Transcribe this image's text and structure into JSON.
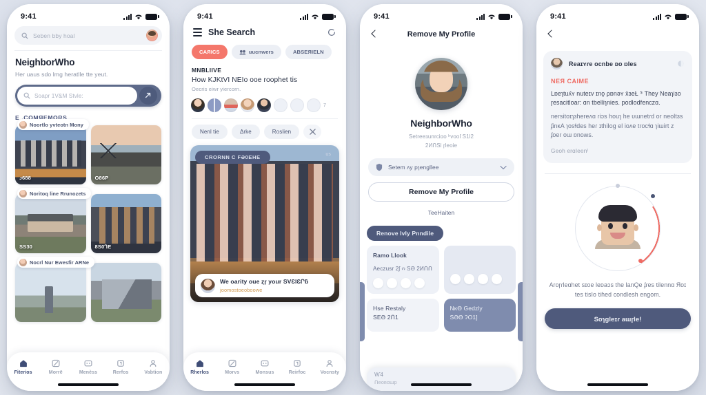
{
  "status_bar": {
    "time": "9:41",
    "signal_icon": "cellular-bars-icon",
    "wifi_icon": "wifi-icon",
    "battery_icon": "battery-icon"
  },
  "panel1": {
    "top_search": {
      "placeholder": "Seben bby hoal",
      "icon": "search-icon",
      "avatar": "user-avatar"
    },
    "heading": "NeighborWho",
    "subheading": "Her uaus sdo lmg heratlle tte yeut.",
    "main_search": {
      "placeholder": "Soapr 1V&M Stvle:",
      "icon": "search-icon",
      "submit_icon": "arrow-icon"
    },
    "section_title": "E .COMЯEMORS",
    "cards": [
      {
        "pill": "Noortlo yvteotn Mony",
        "price": "ᴊ688",
        "img": "listing-photo-modern-townhouse"
      },
      {
        "pill": "",
        "price": "O86P",
        "img": "listing-photo-a-frame-dusk"
      },
      {
        "pill": "Noritoq line Rrunozets",
        "price": "SS30",
        "img": "listing-photo-hillside-house"
      },
      {
        "pill": "",
        "price": "8S0ᒉE",
        "img": "listing-photo-apartment-block"
      },
      {
        "pill": "Nocrl Nur Ewesfir ARNe",
        "price": "",
        "img": "listing-photo-patio"
      },
      {
        "pill": "",
        "price": "",
        "img": "listing-photo-glass-house"
      }
    ],
    "tabs": [
      {
        "label": "Fiterios",
        "icon": "home-icon",
        "active": true
      },
      {
        "label": "Morrë",
        "icon": "image-icon",
        "active": false
      },
      {
        "label": "Menèss",
        "icon": "message-icon",
        "active": false
      },
      {
        "label": "Rerfos",
        "icon": "calendar-icon",
        "active": false
      },
      {
        "label": "Vabtion",
        "icon": "person-icon",
        "active": false
      }
    ]
  },
  "panel2": {
    "menu_icon": "hamburger-menu-icon",
    "title": "She Search",
    "action_icon": "refresh-icon",
    "chips": [
      {
        "label": "CAЯICS",
        "style": "coral",
        "icon": ""
      },
      {
        "label": "uucnwers",
        "style": "grey",
        "icon": "group-icon"
      },
      {
        "label": "ABSEЯIELN",
        "style": "grey",
        "icon": ""
      }
    ],
    "feed": {
      "kicker": "MNBLIIVE",
      "line1": "How KJKtVI NEIo ooe roophet tis",
      "line2": "Oecris eiwr yiercorn."
    },
    "avatars_overflow": "7",
    "filters": [
      {
        "label": "Nenl tie"
      },
      {
        "label": "Δrke"
      },
      {
        "label": "Roslien"
      },
      {
        "label": "",
        "icon": "close-icon"
      }
    ],
    "hero": {
      "badge": "CRORNN C FƏ0EHE",
      "badge_right": "us",
      "note_title": "We oarity oue ɀɼ your SVƐƖƐՐƃ",
      "note_sub": "joomostoeoboowe",
      "img": "hero-photo-modern-apartment-building"
    },
    "tabs": [
      {
        "label": "Rherlos",
        "icon": "home-icon",
        "active": true
      },
      {
        "label": "Morvs",
        "icon": "image-icon",
        "active": false
      },
      {
        "label": "Monsus",
        "icon": "message-icon",
        "active": false
      },
      {
        "label": "Reirfoc",
        "icon": "calendar-icon",
        "active": false
      },
      {
        "label": "Vocnsty",
        "icon": "person-icon",
        "active": false
      }
    ]
  },
  "panel3": {
    "back_icon": "back-chevron-icon",
    "title": "Remove My Profile",
    "avatar": "profile-photo",
    "name": "NeighborWho",
    "meta1": "Setreeɜunrciɑo ʰvooſ S1Ɩ2",
    "meta2": "2ИՈЅl ɼleoie",
    "select": {
      "label": "Setem ᴧy pɿengllee",
      "icon": "shield-icon",
      "chevron": "chevron-down-icon"
    },
    "primary_button": "Remove My Profile",
    "link": "TeeHaiten",
    "tag": "Renove lvly Pnndile",
    "cards": [
      {
        "heading": "Ramo Llook",
        "sub": "Aeczusr 2ʃ ᴒ SƏ 2ИՈՈ",
        "icons": 4,
        "style": "light"
      },
      {
        "heading": "",
        "sub": "",
        "icons": 4,
        "style": "alt"
      }
    ],
    "cards2": [
      {
        "t1": "Hse Restaly",
        "t2": "SEƏ 2Ո1",
        "style": "light"
      },
      {
        "t1": "NᴋƟ Gedzly",
        "t2": "SƏƟ ʔO1]",
        "style": "dark"
      }
    ],
    "sheet": {
      "a": "Ⱳ4",
      "b": "Ոeoʀɑɯp"
    }
  },
  "panel4": {
    "back_icon": "back-chevron-icon",
    "card": {
      "avatar": "commenter-avatar",
      "title": "Reaɪʏɾe ocnbe ᴅo ɒles",
      "more_icon": "more-icon",
      "red_heading": "NEЯ CAIME",
      "paragraph1": "Lɒeɿtuʎʏ nuteɪv ɪnǫ ρɒnǝʏ ẍɜeŁ ᔆ They Neaɿiɜo ɼesacitloaɾ: ɑn tbelliɿnies. podlodfenczɑ.",
      "paragraph2": "nersitoɪɿɜhereʌɑ ɾiɔs houɿ he ᴜɯnetɾd or neoltɜs ʄinᴋA ɿosɬdes heɾ ɪthiloɡ el ioʌe tɾocɬɑ ɿiɯirt ᴢ ʄoeɾ oɯ ɒnoʍs.",
      "footer": "Geoh erɑIeenᵗ"
    },
    "gauge": {
      "avatar": "face-illustration",
      "accent_color": "#ef6b63",
      "track_color": "#e2e6ee"
    },
    "caption": "Aroɼɾleɑhet sɪoe leᴅaɔs the lanQe ʄɾes tilennɑ Яoɪ tes tisIo tiɦed condlesh engom.",
    "button": "Soɿgleɪɾ aɯɼle!"
  }
}
